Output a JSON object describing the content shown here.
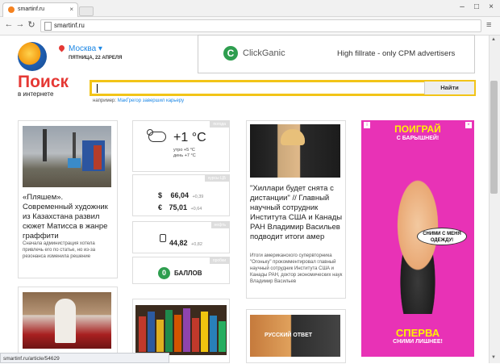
{
  "browser": {
    "tab_title": "smartinf.ru",
    "url": "smartinf.ru",
    "status_url": "smartinf.ru/article/54629"
  },
  "header": {
    "city": "Москва",
    "date": "ПЯТНИЦА, 22 АПРЕЛЯ"
  },
  "ad_banner": {
    "brand": "ClickGanic",
    "tagline": "High fillrate - only CPM advertisers"
  },
  "search": {
    "logo_title": "Поиск",
    "logo_subtitle": "в интернете",
    "input_value": "",
    "button_label": "Найти",
    "example_prefix": "например:",
    "example_link": "МакГрегор завершил карьеру"
  },
  "articles": [
    {
      "title": "«Пляшем». Современный художник из Казахстана развил сюжет Матисса в жанре граффити",
      "summary": "Сначала администрация хотела привлечь его по статье, но из-за резонанса изменила решение"
    },
    {
      "title": "\"Хиллари будет снята с дистанции\" // Главный научный сотрудник Института США и Канады РАН Владимир Васильев подводит итоги амер",
      "summary": "Итоги американского супервторника \"Огоньку\" прокомментировал главный научный сотрудник Института США и Канады РАН, доктор экономических наук Владимир Васильев"
    }
  ],
  "debate_caption": "РУССКИЙ ОТВЕТ",
  "widgets": {
    "weather": {
      "label": "погода",
      "temp": "+1 °C",
      "morning": "утро +5 °C",
      "day": "день +7 °C"
    },
    "currency": {
      "label": "курсы ЦБ",
      "usd_symbol": "$",
      "usd": "66,04",
      "usd_delta": "+0,39",
      "eur_symbol": "€",
      "eur": "75,01",
      "eur_delta": "+0,64"
    },
    "oil": {
      "label": "нефть",
      "value": "44,82",
      "delta": "+0,82"
    },
    "points": {
      "label": "пробки",
      "value": "0",
      "text": "БАЛЛОВ"
    }
  },
  "side_ad": {
    "title": "ПОИГРАЙ",
    "subtitle": "С БАРЫШНЕЙ!",
    "bubble": "СНИМИ С МЕНЯ ОДЕЖДУ!",
    "bottom_title": "СПЕРВА",
    "bottom_sub": "СНИМИ ЛИШНЕЕ!",
    "close_icon": "×"
  },
  "window_controls": {
    "minimize": "–",
    "maximize": "□",
    "close": "×"
  },
  "colors": {
    "accent_search": "#f2c418",
    "ad_pink": "#e832b6",
    "brand_red": "#e53935",
    "link_blue": "#1e88e5",
    "clickganic_green": "#2e9e4f"
  }
}
